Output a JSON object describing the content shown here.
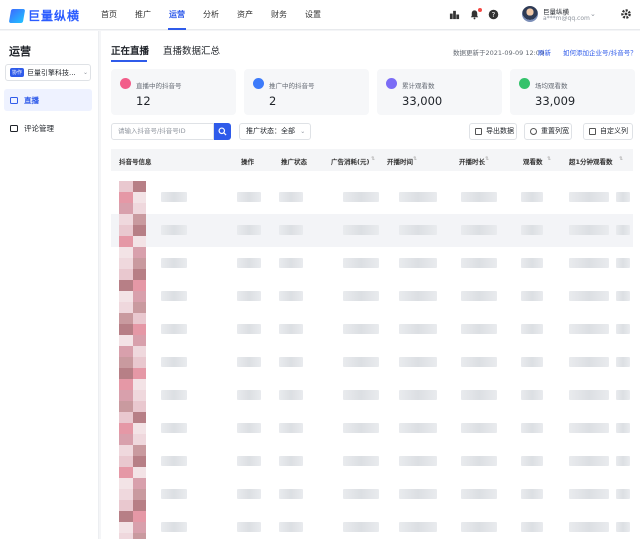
{
  "brand": {
    "logo_text": "巨量纵横",
    "accent": "#2f5bea"
  },
  "nav": {
    "items": [
      {
        "label": "首页",
        "active": false
      },
      {
        "label": "推广",
        "active": false
      },
      {
        "label": "运营",
        "active": true
      },
      {
        "label": "分析",
        "active": false
      },
      {
        "label": "资产",
        "active": false
      },
      {
        "label": "财务",
        "active": false
      },
      {
        "label": "设置",
        "active": false
      }
    ],
    "icons": [
      "leaderboard-icon",
      "bell-icon",
      "help-icon",
      "gear-icon"
    ]
  },
  "user": {
    "name": "巨量纵横",
    "email": "a***m@qq.com"
  },
  "sidebar": {
    "title": "运营",
    "account": {
      "badge": "协作",
      "name": "巨量引擎科技..."
    },
    "items": [
      {
        "label": "直播",
        "icon": "live-icon",
        "active": true
      },
      {
        "label": "评论管理",
        "icon": "comment-icon",
        "active": false
      }
    ]
  },
  "main": {
    "tabs": [
      {
        "label": "正在直播",
        "active": true
      },
      {
        "label": "直播数据汇总",
        "active": false
      }
    ],
    "updated_text": "数据更新于2021-09-09 12:09",
    "refresh_label": "刷新",
    "help_link": "如何添加企业号/抖音号？",
    "stats": [
      {
        "label": "直播中的抖音号",
        "value": "12",
        "color": "#f25d8a",
        "icon": "live-dot-icon"
      },
      {
        "label": "推广中的抖音号",
        "value": "2",
        "color": "#3d7bfa",
        "icon": "send-icon"
      },
      {
        "label": "累计观看数",
        "value": "33,000",
        "color": "#7b6cf6",
        "icon": "user-icon"
      },
      {
        "label": "场均观看数",
        "value": "33,009",
        "color": "#34c26b",
        "icon": "user-icon"
      }
    ],
    "search_placeholder": "请输入抖音号/抖音号ID",
    "filter_label": "推广状态：全部",
    "toolbar": {
      "export_label": "导出数据",
      "reset_label": "重置列宽",
      "custom_label": "自定义列"
    },
    "table": {
      "columns": [
        "抖音号信息",
        "操作",
        "推广状态",
        "广告消耗(元)",
        "开播时间",
        "开播时长",
        "观看数",
        "超1分钟观看数"
      ],
      "row_count": 11
    }
  }
}
